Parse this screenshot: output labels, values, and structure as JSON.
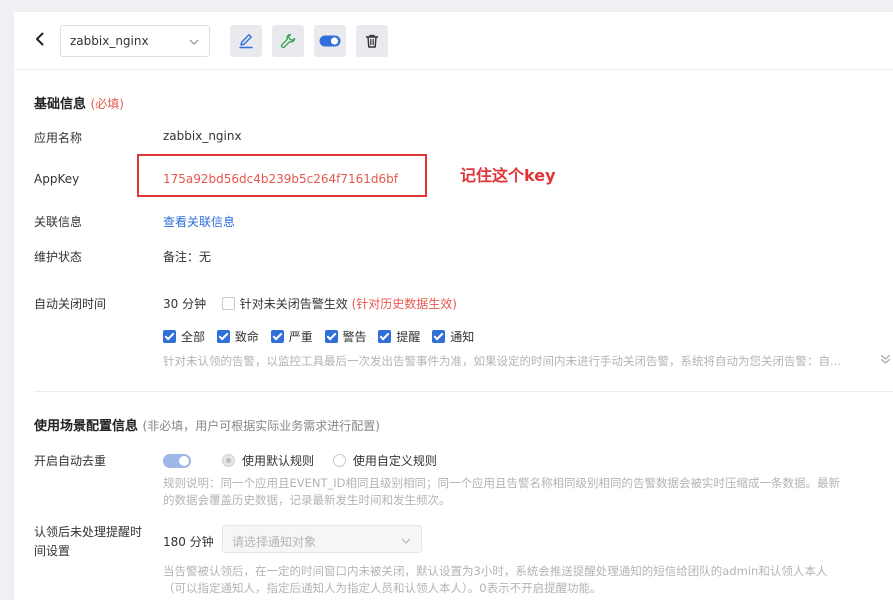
{
  "header": {
    "app_select_value": "zabbix_nginx"
  },
  "basic": {
    "title": "基础信息",
    "required": "(必填)",
    "app_name_label": "应用名称",
    "app_name_value": "zabbix_nginx",
    "appkey_label": "AppKey",
    "appkey_value": "175a92bd56dc4b239b5c264f7161d6bf",
    "appkey_note": "记住这个key",
    "related_label": "关联信息",
    "related_link": "查看关联信息",
    "maint_label": "维护状态",
    "maint_value": "备注：无",
    "autoclose_label": "自动关闭时间",
    "autoclose_value": "30 分钟",
    "unclosed_label": "针对未关闭告警生效",
    "history_note": "(针对历史数据生效)",
    "levels": [
      "全部",
      "致命",
      "严重",
      "警告",
      "提醒",
      "通知"
    ],
    "autoclose_hint": "针对未认领的告警，以监控工具最后一次发出告警事件为准，如果设定的时间内未进行手动关闭告警，系统将自动为您关闭告警：自..."
  },
  "scenario": {
    "title": "使用场景配置信息",
    "subtitle": "(非必填，用户可根据实际业务需求进行配置)",
    "dedup_label": "开启自动去重",
    "radio_default": "使用默认规则",
    "radio_custom": "使用自定义规则",
    "dedup_hint_1": "规则说明：同一个应用且EVENT_ID相同且级别相同；同一个应用且告警名称相同级别相同的告警数据会被实时压缩成一条数据。最新",
    "dedup_hint_2": "的数据会覆盖历史数据，记录最新发生时间和发生频次。",
    "remind_label_1": "认领后未处理提醒时",
    "remind_label_2": "间设置",
    "remind_value": "180 分钟",
    "notify_placeholder": "请选择通知对象",
    "remind_hint_1": "当告警被认领后，在一定的时间窗口内未被关闭，默认设置为3小时，系统会推送提醒处理通知的短信给团队的admin和认领人本人",
    "remind_hint_2": "（可以指定通知人，指定后通知人为指定人员和认领人本人）。0表示不开启提醒功能。"
  },
  "colors": {
    "accent": "#2f6fd8",
    "danger": "#e8574f",
    "annotation": "#e0363a"
  }
}
